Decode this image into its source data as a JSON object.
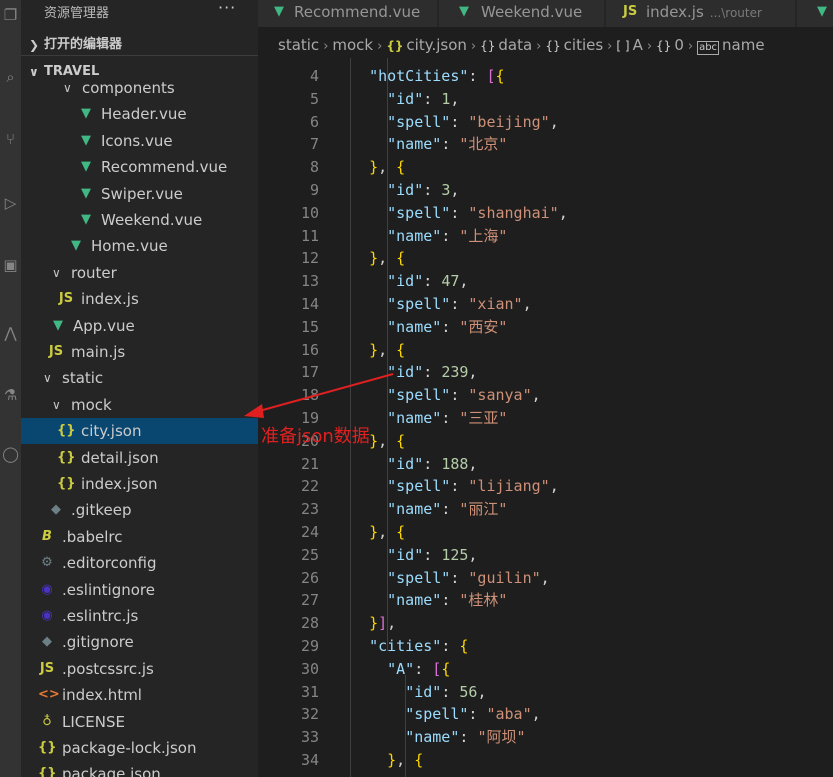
{
  "sidebar": {
    "title": "资源管理器",
    "more": "···",
    "open_editors": "打开的编辑器",
    "project": "TRAVEL",
    "tree": [
      {
        "label": "components",
        "icon": "chevron-down-icon",
        "type": "folder"
      },
      {
        "label": "Header.vue",
        "icon": "vue-icon",
        "type": "vue"
      },
      {
        "label": "Icons.vue",
        "icon": "vue-icon",
        "type": "vue"
      },
      {
        "label": "Recommend.vue",
        "icon": "vue-icon",
        "type": "vue"
      },
      {
        "label": "Swiper.vue",
        "icon": "vue-icon",
        "type": "vue"
      },
      {
        "label": "Weekend.vue",
        "icon": "vue-icon",
        "type": "vue"
      },
      {
        "label": "Home.vue",
        "icon": "vue-icon",
        "type": "vue"
      },
      {
        "label": "router",
        "icon": "chevron-down-icon",
        "type": "folder"
      },
      {
        "label": "index.js",
        "icon": "js-icon",
        "type": "js"
      },
      {
        "label": "App.vue",
        "icon": "vue-icon",
        "type": "vue"
      },
      {
        "label": "main.js",
        "icon": "js-icon",
        "type": "js"
      },
      {
        "label": "static",
        "icon": "chevron-down-icon",
        "type": "folder"
      },
      {
        "label": "mock",
        "icon": "chevron-down-icon",
        "type": "folder"
      },
      {
        "label": "city.json",
        "icon": "json-icon",
        "type": "json"
      },
      {
        "label": "detail.json",
        "icon": "json-icon",
        "type": "json"
      },
      {
        "label": "index.json",
        "icon": "json-icon",
        "type": "json"
      },
      {
        "label": ".gitkeep",
        "icon": "dot-icon",
        "type": "file"
      },
      {
        "label": ".babelrc",
        "icon": "babel-icon",
        "type": "file"
      },
      {
        "label": ".editorconfig",
        "icon": "gear-icon",
        "type": "file"
      },
      {
        "label": ".eslintignore",
        "icon": "eslint-icon",
        "type": "file"
      },
      {
        "label": ".eslintrc.js",
        "icon": "eslint-icon",
        "type": "file"
      },
      {
        "label": ".gitignore",
        "icon": "git-icon",
        "type": "file"
      },
      {
        "label": ".postcssrc.js",
        "icon": "js-icon",
        "type": "js"
      },
      {
        "label": "index.html",
        "icon": "html-icon",
        "type": "html"
      },
      {
        "label": "LICENSE",
        "icon": "license-icon",
        "type": "file"
      },
      {
        "label": "package-lock.json",
        "icon": "json-icon",
        "type": "json"
      },
      {
        "label": "package.json",
        "icon": "json-icon",
        "type": "json"
      }
    ],
    "icons": {
      "vue": "▼",
      "js": "JS",
      "json": "{}",
      "html": "<>",
      "dot": "◆",
      "babel": "B",
      "gear": "⚙",
      "eslint": "◉",
      "git": "◆",
      "license": "♁"
    }
  },
  "tabs": [
    {
      "label": "Recommend.vue",
      "icon": "vue-icon"
    },
    {
      "label": "Weekend.vue",
      "icon": "vue-icon"
    },
    {
      "label": "index.js",
      "sub": "...\\router",
      "icon": "js-icon"
    }
  ],
  "breadcrumb": [
    "static",
    "mock",
    "city.json",
    "data",
    "cities",
    "A",
    "0",
    "name"
  ],
  "breadcrumb_icons": {
    "json": "{}",
    "obj": "{}",
    "arr": "[ ]",
    "str": "abc"
  },
  "editor": {
    "lines": [
      {
        "n": "4",
        "text": "  \"hotCities\": [{"
      },
      {
        "n": "5",
        "text": "    \"id\": 1,"
      },
      {
        "n": "6",
        "text": "    \"spell\": \"beijing\","
      },
      {
        "n": "7",
        "text": "    \"name\": \"北京\""
      },
      {
        "n": "8",
        "text": "  }, {"
      },
      {
        "n": "9",
        "text": "    \"id\": 3,"
      },
      {
        "n": "10",
        "text": "    \"spell\": \"shanghai\","
      },
      {
        "n": "11",
        "text": "    \"name\": \"上海\""
      },
      {
        "n": "12",
        "text": "  }, {"
      },
      {
        "n": "13",
        "text": "    \"id\": 47,"
      },
      {
        "n": "14",
        "text": "    \"spell\": \"xian\","
      },
      {
        "n": "15",
        "text": "    \"name\": \"西安\""
      },
      {
        "n": "16",
        "text": "  }, {"
      },
      {
        "n": "17",
        "text": "    \"id\": 239,"
      },
      {
        "n": "18",
        "text": "    \"spell\": \"sanya\","
      },
      {
        "n": "19",
        "text": "    \"name\": \"三亚\""
      },
      {
        "n": "20",
        "text": "  }, {"
      },
      {
        "n": "21",
        "text": "    \"id\": 188,"
      },
      {
        "n": "22",
        "text": "    \"spell\": \"lijiang\","
      },
      {
        "n": "23",
        "text": "    \"name\": \"丽江\""
      },
      {
        "n": "24",
        "text": "  }, {"
      },
      {
        "n": "25",
        "text": "    \"id\": 125,"
      },
      {
        "n": "26",
        "text": "    \"spell\": \"guilin\","
      },
      {
        "n": "27",
        "text": "    \"name\": \"桂林\""
      },
      {
        "n": "28",
        "text": "  }],"
      },
      {
        "n": "29",
        "text": "  \"cities\": {"
      },
      {
        "n": "30",
        "text": "    \"A\": [{"
      },
      {
        "n": "31",
        "text": "      \"id\": 56,"
      },
      {
        "n": "32",
        "text": "      \"spell\": \"aba\","
      },
      {
        "n": "33",
        "text": "      \"name\": \"阿坝\""
      },
      {
        "n": "34",
        "text": "    }, {"
      }
    ]
  },
  "annotation": {
    "text": "准备json数据",
    "color": "#e02020"
  },
  "colors": {
    "selection": "#094771",
    "sidebar": "#252526",
    "editor": "#1e1e1e",
    "vue": "#41b883",
    "json": "#cbcb41"
  }
}
